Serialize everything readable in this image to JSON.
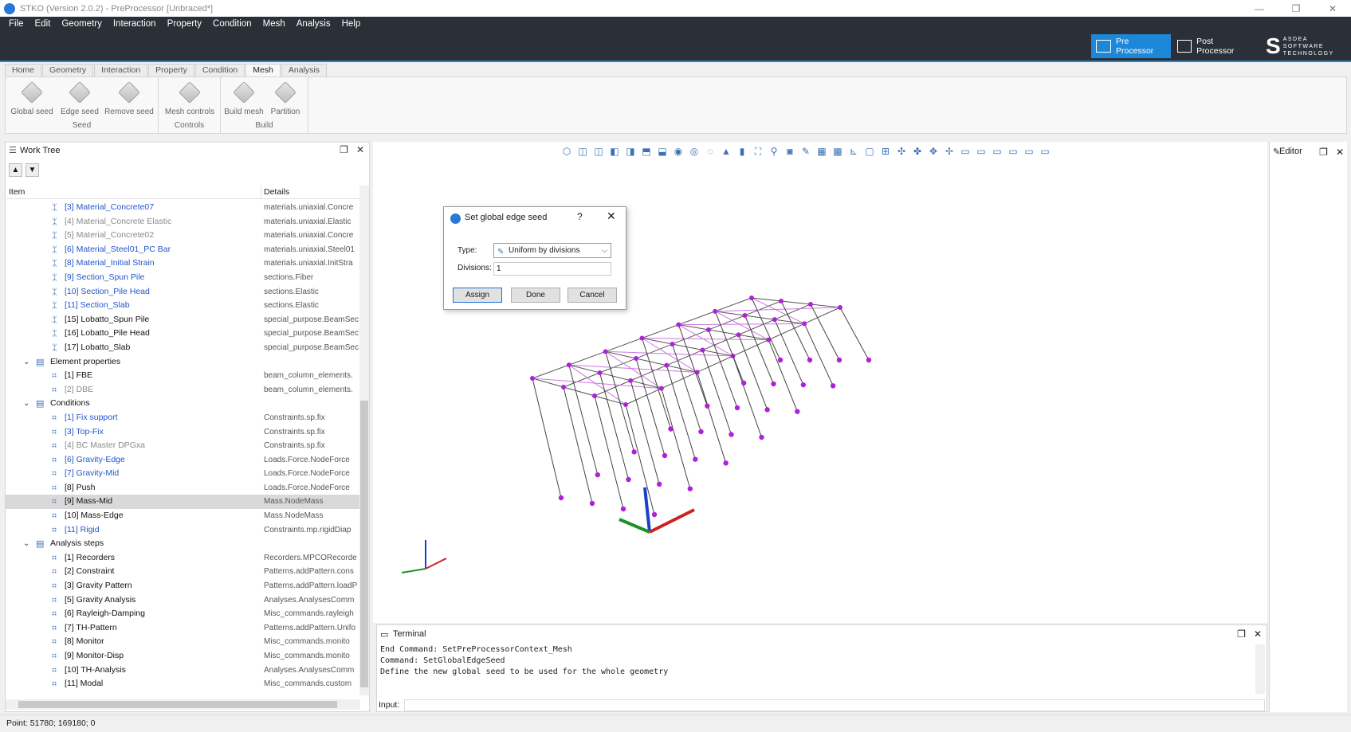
{
  "window": {
    "title": "STKO (Version 2.0.2) - PreProcessor [Unbraced*]",
    "controls": [
      "—",
      "❐",
      "✕"
    ]
  },
  "menu": [
    "File",
    "Edit",
    "Geometry",
    "Interaction",
    "Property",
    "Condition",
    "Mesh",
    "Analysis",
    "Help"
  ],
  "modes": {
    "pre": "Pre Processor",
    "post": "Post Processor"
  },
  "brand": {
    "line1": "ASDEA",
    "line2": "SOFTWARE",
    "line3": "TECHNOLOGY"
  },
  "ribbon": {
    "tabs": [
      "Home",
      "Geometry",
      "Interaction",
      "Property",
      "Condition",
      "Mesh",
      "Analysis"
    ],
    "active_tab": "Mesh",
    "groups": [
      {
        "label": "Seed",
        "buttons": [
          "Global seed",
          "Edge seed",
          "Remove seed"
        ]
      },
      {
        "label": "Controls",
        "buttons": [
          "Mesh controls"
        ]
      },
      {
        "label": "Build",
        "buttons": [
          "Build mesh",
          "Partition"
        ]
      }
    ]
  },
  "worktree": {
    "title": "Work Tree",
    "columns": {
      "item": "Item",
      "details": "Details"
    },
    "rows": [
      {
        "label": "[3] Material_Concrete07",
        "details": "materials.uniaxial.Concre",
        "style": "blue",
        "indent": 2
      },
      {
        "label": "[4] Material_Concrete Elastic",
        "details": "materials.uniaxial.Elastic",
        "style": "gray",
        "indent": 2
      },
      {
        "label": "[5] Material_Concrete02",
        "details": "materials.uniaxial.Concre",
        "style": "gray",
        "indent": 2
      },
      {
        "label": "[6] Material_Steel01_PC Bar",
        "details": "materials.uniaxial.Steel01",
        "style": "blue",
        "indent": 2
      },
      {
        "label": "[8] Material_Initial Strain",
        "details": "materials.uniaxial.InitStra",
        "style": "blue",
        "indent": 2
      },
      {
        "label": "[9] Section_Spun Pile",
        "details": "sections.Fiber",
        "style": "blue",
        "indent": 2
      },
      {
        "label": "[10] Section_Pile Head",
        "details": "sections.Elastic",
        "style": "blue",
        "indent": 2
      },
      {
        "label": "[11] Section_Slab",
        "details": "sections.Elastic",
        "style": "blue",
        "indent": 2
      },
      {
        "label": "[15] Lobatto_Spun Pile",
        "details": "special_purpose.BeamSec",
        "style": "black",
        "indent": 2
      },
      {
        "label": "[16] Lobatto_Pile Head",
        "details": "special_purpose.BeamSec",
        "style": "black",
        "indent": 2
      },
      {
        "label": "[17] Lobatto_Slab",
        "details": "special_purpose.BeamSec",
        "style": "black",
        "indent": 2
      },
      {
        "label": "Element properties",
        "details": "",
        "style": "black",
        "indent": 1,
        "group": true
      },
      {
        "label": "[1] FBE",
        "details": "beam_column_elements.",
        "style": "black",
        "indent": 2
      },
      {
        "label": "[2] DBE",
        "details": "beam_column_elements.",
        "style": "gray",
        "indent": 2
      },
      {
        "label": "Conditions",
        "details": "",
        "style": "black",
        "indent": 1,
        "group": true
      },
      {
        "label": "[1] Fix support",
        "details": "Constraints.sp.fix",
        "style": "blue",
        "indent": 2
      },
      {
        "label": "[3] Top-Fix",
        "details": "Constraints.sp.fix",
        "style": "blue",
        "indent": 2
      },
      {
        "label": "[4] BC Master DPGxa",
        "details": "Constraints.sp.fix",
        "style": "gray",
        "indent": 2
      },
      {
        "label": "[6] Gravity-Edge",
        "details": "Loads.Force.NodeForce",
        "style": "blue",
        "indent": 2
      },
      {
        "label": "[7] Gravity-Mid",
        "details": "Loads.Force.NodeForce",
        "style": "blue",
        "indent": 2
      },
      {
        "label": "[8] Push",
        "details": "Loads.Force.NodeForce",
        "style": "black",
        "indent": 2
      },
      {
        "label": "[9] Mass-Mid",
        "details": "Mass.NodeMass",
        "style": "black",
        "indent": 2,
        "selected": true
      },
      {
        "label": "[10] Mass-Edge",
        "details": "Mass.NodeMass",
        "style": "black",
        "indent": 2
      },
      {
        "label": "[11] Rigid",
        "details": "Constraints.mp.rigidDiap",
        "style": "blue",
        "indent": 2
      },
      {
        "label": "Analysis steps",
        "details": "",
        "style": "black",
        "indent": 1,
        "group": true
      },
      {
        "label": "[1] Recorders",
        "details": "Recorders.MPCORecorde",
        "style": "black",
        "indent": 2
      },
      {
        "label": "[2] Constraint",
        "details": "Patterns.addPattern.cons",
        "style": "black",
        "indent": 2
      },
      {
        "label": "[3] Gravity Pattern",
        "details": "Patterns.addPattern.loadP",
        "style": "black",
        "indent": 2
      },
      {
        "label": "[5] Gravity Analysis",
        "details": "Analyses.AnalysesComm",
        "style": "black",
        "indent": 2
      },
      {
        "label": "[6] Rayleigh-Damping",
        "details": "Misc_commands.rayleigh",
        "style": "black",
        "indent": 2
      },
      {
        "label": "[7] TH-Pattern",
        "details": "Patterns.addPattern.Unifo",
        "style": "black",
        "indent": 2
      },
      {
        "label": "[8] Monitor",
        "details": "Misc_commands.monito",
        "style": "black",
        "indent": 2
      },
      {
        "label": "[9] Monitor-Disp",
        "details": "Misc_commands.monito",
        "style": "black",
        "indent": 2
      },
      {
        "label": "[10] TH-Analysis",
        "details": "Analyses.AnalysesComm",
        "style": "black",
        "indent": 2
      },
      {
        "label": "[11] Modal",
        "details": "Misc_commands.custom",
        "style": "black",
        "indent": 2
      }
    ]
  },
  "editor": {
    "title": "Editor"
  },
  "dialog": {
    "title": "Set global edge seed",
    "help": "?",
    "type_label": "Type:",
    "type_value": "Uniform by divisions",
    "divisions_label": "Divisions:",
    "divisions_value": "1",
    "assign": "Assign",
    "done": "Done",
    "cancel": "Cancel"
  },
  "terminal": {
    "title": "Terminal",
    "lines": [
      "End Command: SetPreProcessorContext_Mesh",
      "Command: SetGlobalEdgeSeed",
      "Define the new global seed to be used for the whole geometry"
    ],
    "input_label": "Input:"
  },
  "status": {
    "text": "Point: 51780; 169180; 0"
  },
  "colors": {
    "accent": "#1e88d8",
    "node": "#b020d8",
    "mesh_line": "#cc77e0"
  }
}
